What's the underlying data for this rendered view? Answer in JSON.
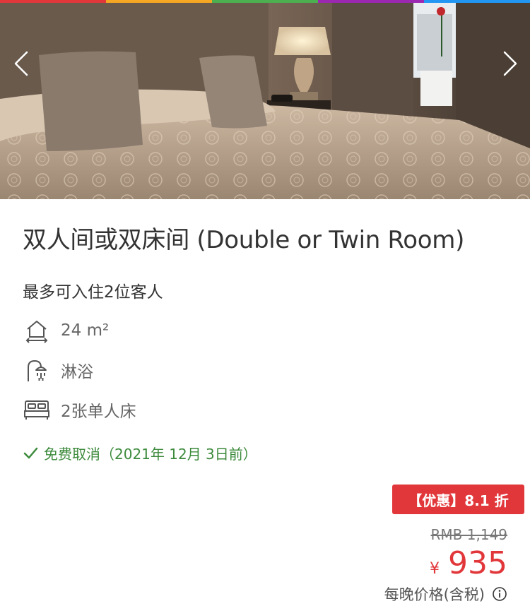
{
  "colors": {
    "stripe": [
      "#e2373a",
      "#f5a623",
      "#4caf50",
      "#9c27b0",
      "#2196f3"
    ],
    "accent_red": "#e2373a",
    "success_green": "#3c8a3c"
  },
  "gallery": {
    "prev_icon": "chevron-left-icon",
    "next_icon": "chevron-right-icon"
  },
  "room": {
    "title": "双人间或双床间 (Double or Twin Room)",
    "capacity": "最多可入住2位客人",
    "features": [
      {
        "icon": "area-icon",
        "text": "24 m²"
      },
      {
        "icon": "shower-icon",
        "text": "淋浴"
      },
      {
        "icon": "bed-icon",
        "text": "2张单人床"
      }
    ],
    "cancellation": {
      "icon": "check-icon",
      "label": "免费取消",
      "date": "（2021年 12月 3日前）"
    }
  },
  "pricing": {
    "discount_badge": "【优惠】8.1 折",
    "original_price": "RMB 1,149",
    "currency": "¥",
    "price": "935",
    "per_night_label": "每晚价格(含税)",
    "info_icon": "info-icon"
  }
}
